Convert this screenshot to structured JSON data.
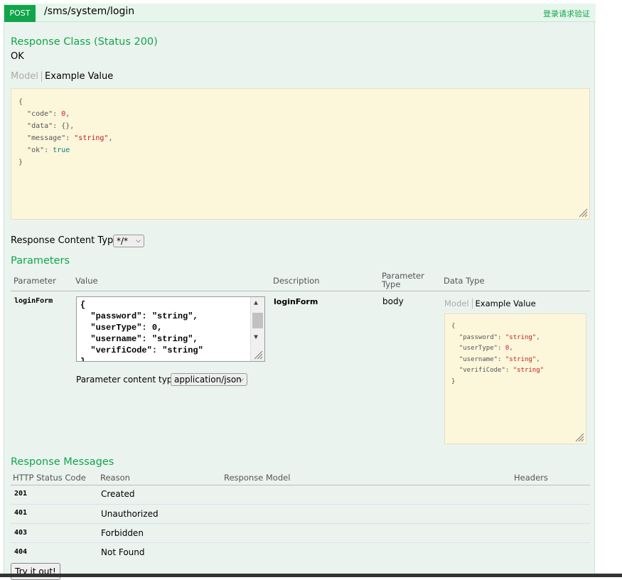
{
  "endpoint": {
    "method": "POST",
    "path": "/sms/system/login",
    "summary": "登录请求验证"
  },
  "response_class": {
    "heading": "Response Class (Status 200)",
    "status_text": "OK",
    "tab_model": "Model",
    "tab_example": "Example Value",
    "example_lines": [
      "{",
      "\"code\": 0,",
      "\"data\": {},",
      "\"message\": \"string\",",
      "\"ok\": true",
      "}"
    ]
  },
  "response_content_type": {
    "label": "Response Content Type",
    "selected": "*/*"
  },
  "parameters": {
    "heading": "Parameters",
    "columns": [
      "Parameter",
      "Value",
      "Description",
      "Parameter Type",
      "Data Type"
    ],
    "row": {
      "name": "loginForm",
      "value_lines": [
        "{",
        "  \"password\": \"string\",",
        "  \"userType\": 0,",
        "  \"username\": \"string\",",
        "  \"verifiCode\": \"string\"",
        "}"
      ],
      "description": "loginForm",
      "param_type": "body",
      "tab_model": "Model",
      "tab_example": "Example Value",
      "example_lines": [
        "{",
        "\"password\": \"string\",",
        "\"userType\": 0,",
        "\"username\": \"string\",",
        "\"verifiCode\": \"string\"",
        "}"
      ],
      "content_type_label": "Parameter content type:",
      "content_type_selected": "application/json"
    }
  },
  "response_messages": {
    "heading": "Response Messages",
    "columns": [
      "HTTP Status Code",
      "Reason",
      "Response Model",
      "Headers"
    ],
    "rows": [
      {
        "code": "201",
        "reason": "Created"
      },
      {
        "code": "401",
        "reason": "Unauthorized"
      },
      {
        "code": "403",
        "reason": "Forbidden"
      },
      {
        "code": "404",
        "reason": "Not Found"
      }
    ]
  },
  "try_button": "Try it out!",
  "colors": {
    "accent_green": "#10a54a",
    "panel_bg": "#ebf3ef",
    "code_bg": "#fcf6db"
  }
}
